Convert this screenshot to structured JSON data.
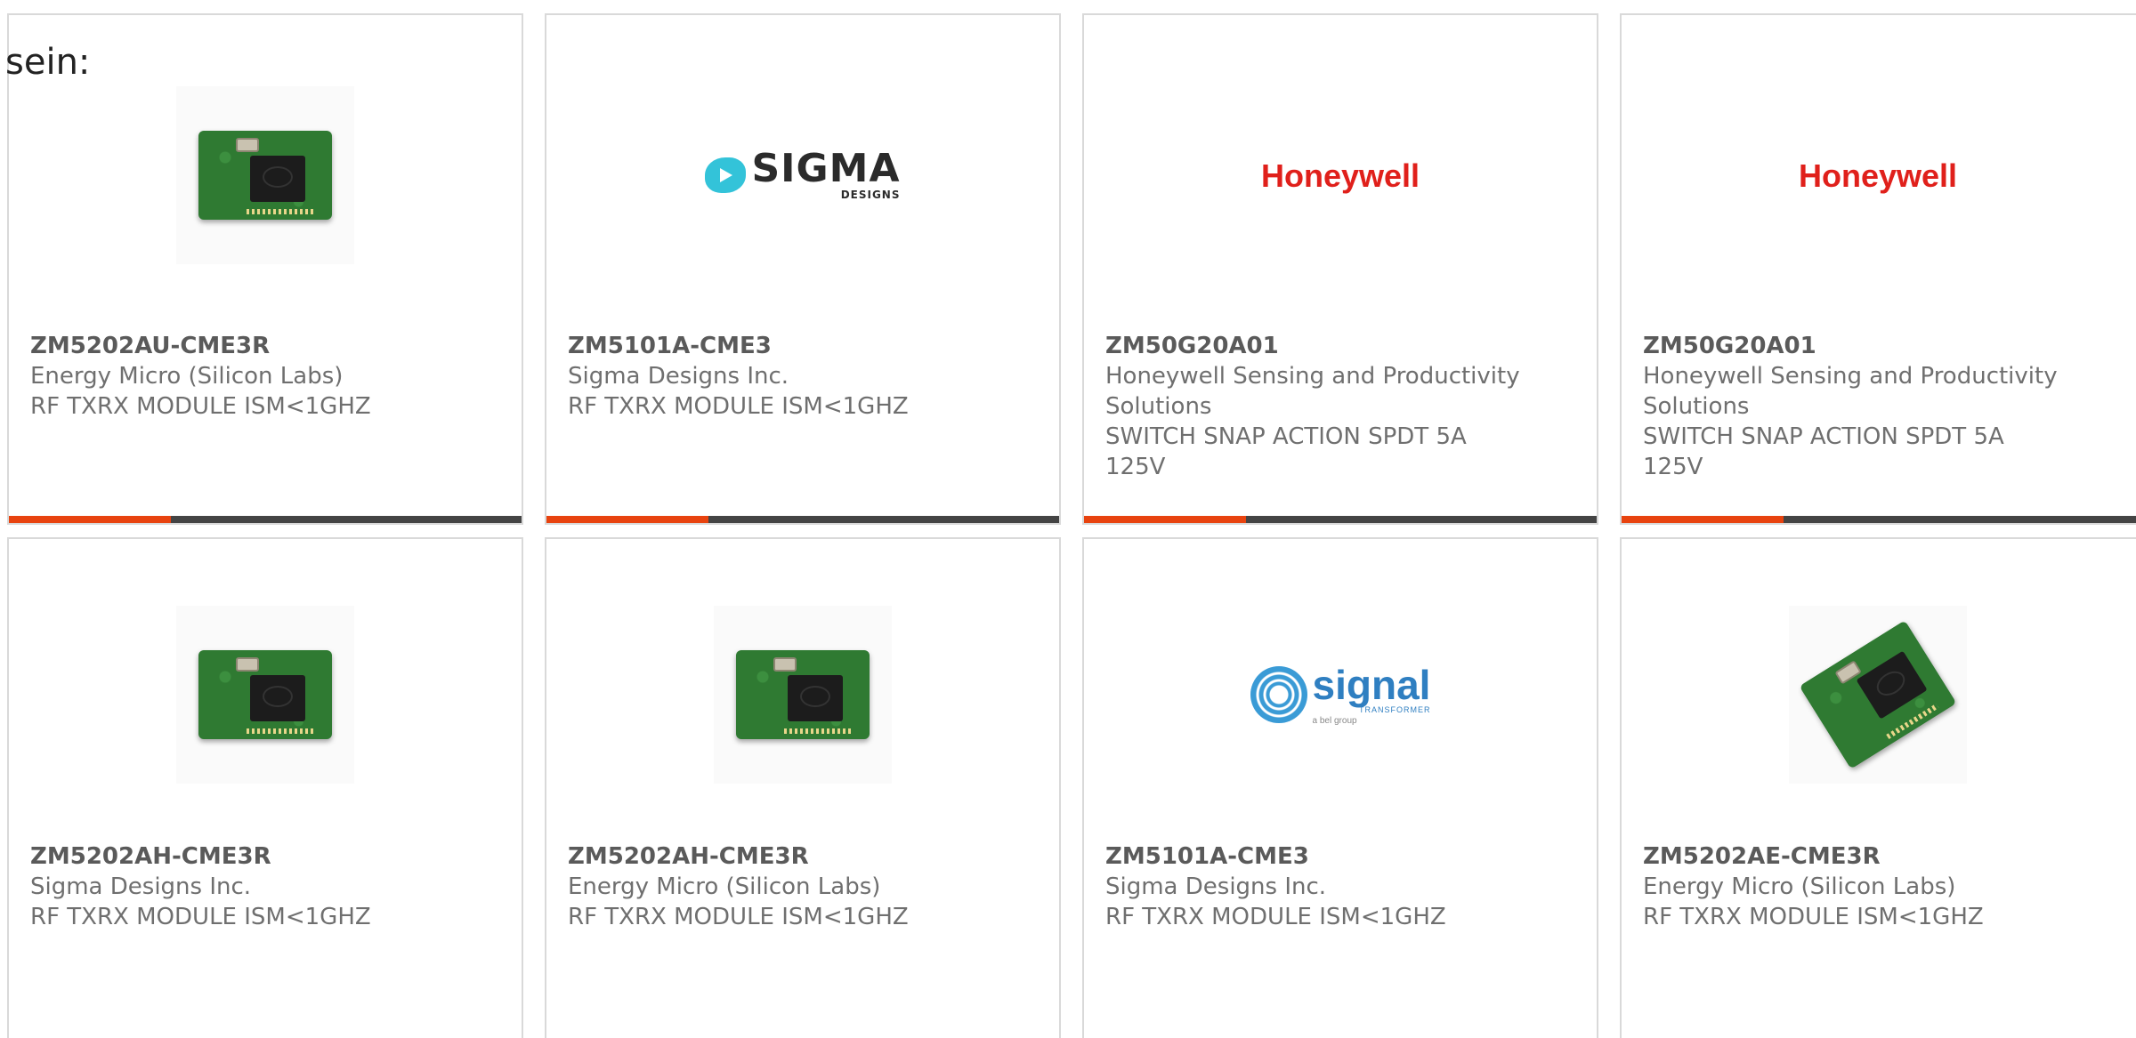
{
  "intro_text": "sein:",
  "colors": {
    "accent": "#e8430f",
    "bar": "#444444",
    "card_border": "#d9d9d9"
  },
  "cards": [
    {
      "part_number": "ZM5202AU-CME3R",
      "manufacturer": "Energy Micro (Silicon Labs)",
      "description": "RF TXRX MODULE ISM<1GHZ",
      "image": "chip-module-photo"
    },
    {
      "part_number": "ZM5101A-CME3",
      "manufacturer": "Sigma Designs Inc.",
      "description": "RF TXRX MODULE ISM<1GHZ",
      "image": "sigma-designs-logo",
      "logo": {
        "big": "SIGMA",
        "small": "DESIGNS"
      }
    },
    {
      "part_number": "ZM50G20A01",
      "manufacturer": "Honeywell Sensing and Productivity Solutions",
      "description": "SWITCH SNAP ACTION SPDT 5A 125V",
      "image": "honeywell-logo",
      "logo": {
        "text": "Honeywell"
      }
    },
    {
      "part_number": "ZM50G20A01",
      "manufacturer": "Honeywell Sensing and Productivity Solutions",
      "description": "SWITCH SNAP ACTION SPDT 5A 125V",
      "image": "honeywell-logo",
      "logo": {
        "text": "Honeywell"
      }
    },
    {
      "part_number": "ZM5202AH-CME3R",
      "manufacturer": "Sigma Designs Inc.",
      "description": "RF TXRX MODULE ISM<1GHZ",
      "image": "chip-module-photo"
    },
    {
      "part_number": "ZM5202AH-CME3R",
      "manufacturer": "Energy Micro (Silicon Labs)",
      "description": "RF TXRX MODULE ISM<1GHZ",
      "image": "chip-module-photo"
    },
    {
      "part_number": "ZM5101A-CME3",
      "manufacturer": "Sigma Designs Inc.",
      "description": "RF TXRX MODULE ISM<1GHZ",
      "image": "signal-transformer-logo",
      "logo": {
        "big": "signal",
        "sub": "TRANSFORMER",
        "bel": "a bel group"
      }
    },
    {
      "part_number": "ZM5202AE-CME3R",
      "manufacturer": "Energy Micro (Silicon Labs)",
      "description": "RF TXRX MODULE ISM<1GHZ",
      "image": "chip-module-photo"
    }
  ]
}
